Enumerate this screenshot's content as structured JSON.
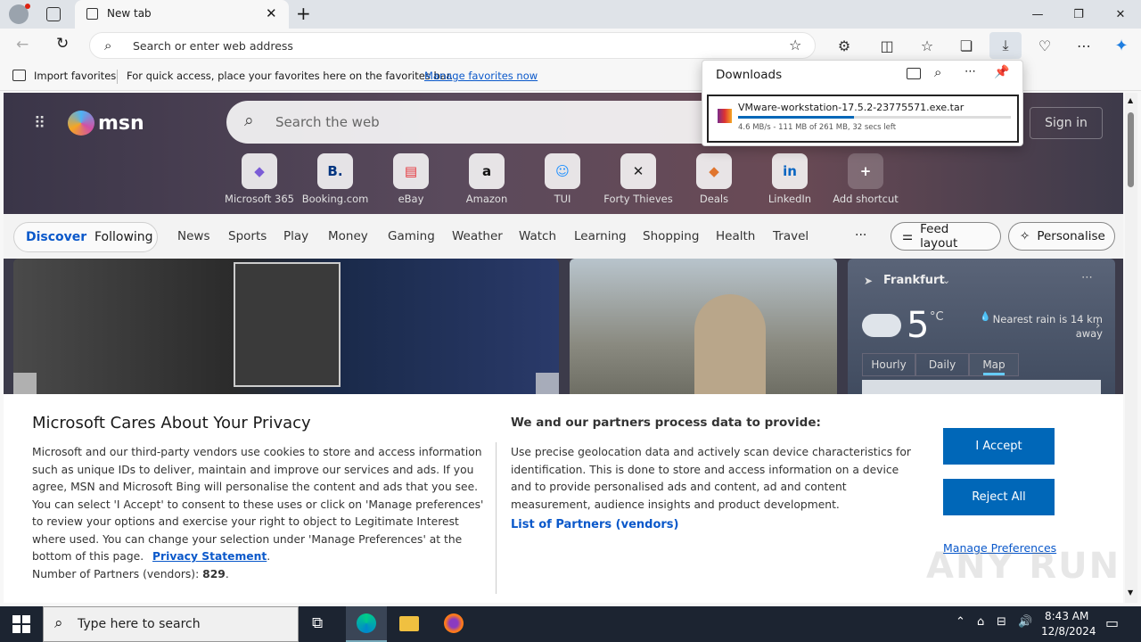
{
  "browser": {
    "tab_title": "New tab",
    "address_placeholder": "Search or enter web address",
    "favbar": {
      "import": "Import favorites",
      "hint": "For quick access, place your favorites here on the favorites bar.",
      "manage_link": "Manage favorites now"
    }
  },
  "downloads": {
    "title": "Downloads",
    "file_name": "VMware-workstation-17.5.2-23775571.exe.tar",
    "status": "4.6 MB/s - 111 MB of 261 MB, 32 secs left",
    "progress": 0.425
  },
  "msn": {
    "logo": "msn",
    "search_placeholder": "Search the web",
    "signin": "Sign in",
    "shortcuts": [
      {
        "label": "Microsoft 365",
        "glyph": "◆",
        "color": "#7b5cd6"
      },
      {
        "label": "Booking.com",
        "glyph": "B.",
        "color": "#003580"
      },
      {
        "label": "eBay",
        "glyph": "▤",
        "color": "#e53238"
      },
      {
        "label": "Amazon",
        "glyph": "a",
        "color": "#111111"
      },
      {
        "label": "TUI",
        "glyph": "☺",
        "color": "#1e90ff"
      },
      {
        "label": "Forty Thieves",
        "glyph": "✕",
        "color": "#222222"
      },
      {
        "label": "Deals",
        "glyph": "◆",
        "color": "#e0752e"
      },
      {
        "label": "LinkedIn",
        "glyph": "in",
        "color": "#0a66c2"
      },
      {
        "label": "Add shortcut",
        "glyph": "+",
        "color": "#ffffff"
      }
    ],
    "nav": {
      "discover": "Discover",
      "following": "Following",
      "items": [
        "News",
        "Sports",
        "Play",
        "Money",
        "Gaming",
        "Weather",
        "Watch",
        "Learning",
        "Shopping",
        "Health",
        "Travel"
      ],
      "more": "···",
      "feed_layout": "Feed layout",
      "personalise": "Personalise"
    },
    "weather": {
      "location": "Frankfurt",
      "temp": "5",
      "unit": "°C",
      "rain": "Nearest rain is 14 km away",
      "tabs": [
        "Hourly",
        "Daily",
        "Map"
      ]
    }
  },
  "privacy": {
    "title": "Microsoft Cares About Your Privacy",
    "body": "Microsoft and our third-party vendors use cookies to store and access information such as unique IDs to deliver, maintain and improve our services and ads. If you agree, MSN and Microsoft Bing will personalise the content and ads that you see. You can select 'I Accept' to consent to these uses or click on 'Manage preferences' to review your options and exercise your right to object to Legitimate Interest where used. You can change your selection under 'Manage Preferences' at the bottom of this page.",
    "statement_link": "Privacy Statement",
    "partners_label": "Number of Partners (vendors):",
    "partners_count": "829",
    "right_title": "We and our partners process data to provide:",
    "right_body": "Use precise geolocation data and actively scan device characteristics for identification. This is done to store and access information on a device and to provide personalised ads and content, ad and content measurement, audience insights and product development.",
    "partners_link": "List of Partners (vendors)",
    "accept": "I Accept",
    "reject": "Reject All",
    "manage": "Manage Preferences"
  },
  "watermark": "ANY RUN",
  "taskbar": {
    "search_placeholder": "Type here to search",
    "time": "8:43 AM",
    "date": "12/8/2024"
  }
}
